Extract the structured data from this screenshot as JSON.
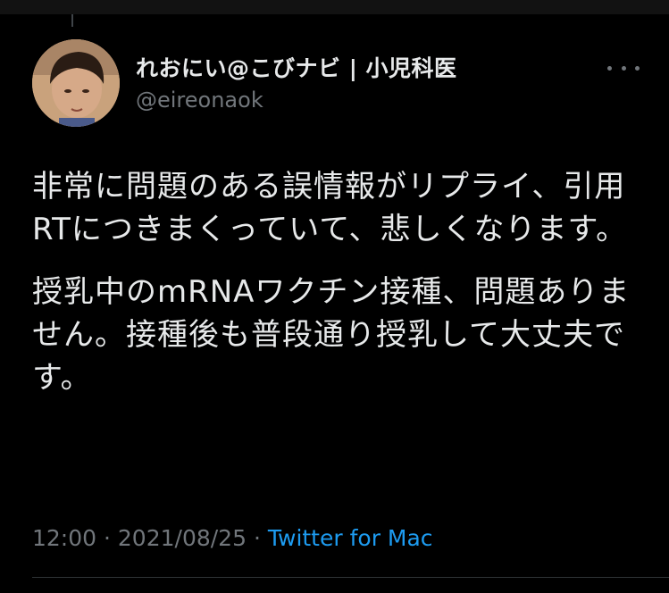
{
  "tweet": {
    "author": {
      "display_name": "れおにい@こびナビ | 小児科医",
      "handle": "@eireonaok"
    },
    "paragraphs": [
      "非常に問題のある誤情報がリプライ、引用RTにつきまくっていて、悲しくなります。",
      "授乳中のmRNAワクチン接種、問題ありません。接種後も普段通り授乳して大丈夫です。"
    ],
    "time": "12:00",
    "separator": "·",
    "date": "2021/08/25",
    "source": "Twitter for Mac"
  },
  "colors": {
    "background": "#000000",
    "text": "#e7e9ea",
    "secondary": "#71767b",
    "link": "#1d9bf0"
  },
  "icons": {
    "more": "more-horizontal-icon"
  }
}
